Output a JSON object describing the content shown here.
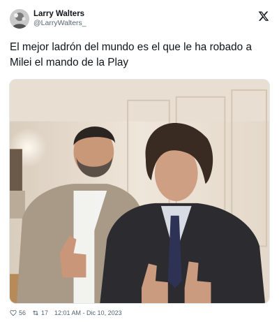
{
  "tweet": {
    "author": {
      "display_name": "Larry Walters",
      "handle": "@LarryWalters_"
    },
    "text": "El mejor ladrón del mundo es el que le ha robado a Milei el mando de la Play",
    "media": {
      "type": "photo",
      "alt": "photo"
    },
    "stats": {
      "likes": "56",
      "retweets": "17",
      "timestamp": "12:01 AM - Dic 10, 2023"
    }
  },
  "icons": {
    "logo": "x-logo-icon",
    "like": "heart-icon",
    "retweet": "retweet-icon"
  },
  "colors": {
    "text": "#0f1419",
    "secondary": "#536471",
    "border": "#e1e8ed"
  }
}
